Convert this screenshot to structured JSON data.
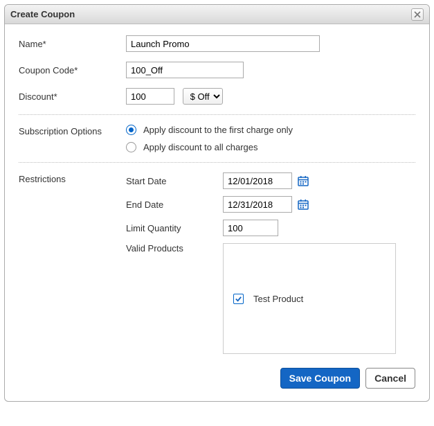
{
  "dialog": {
    "title": "Create Coupon"
  },
  "fields": {
    "name_label": "Name*",
    "name_value": "Launch Promo",
    "code_label": "Coupon Code*",
    "code_value": "100_Off",
    "discount_label": "Discount*",
    "discount_value": "100",
    "discount_type": "$ Off"
  },
  "subscription": {
    "section_label": "Subscription Options",
    "option1": "Apply discount to the first charge only",
    "option2": "Apply discount to all charges"
  },
  "restrictions": {
    "section_label": "Restrictions",
    "start_label": "Start Date",
    "start_value": "12/01/2018",
    "end_label": "End Date",
    "end_value": "12/31/2018",
    "limit_label": "Limit Quantity",
    "limit_value": "100",
    "valid_label": "Valid Products",
    "product0": "Test Product"
  },
  "buttons": {
    "save": "Save Coupon",
    "cancel": "Cancel"
  }
}
